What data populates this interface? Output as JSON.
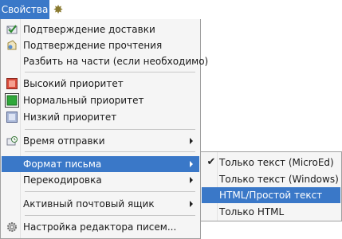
{
  "topbar": {
    "menu_label": "Свойства",
    "gear_icon": "gear-icon"
  },
  "menu": {
    "items": [
      {
        "label": "Подтверждение доставки",
        "icon": "delivery-receipt-icon"
      },
      {
        "label": "Подтверждение прочтения",
        "icon": "read-receipt-icon"
      },
      {
        "label": "Разбить на части (если необходимо)",
        "icon": ""
      },
      {
        "label": "Высокий приоритет",
        "icon": "priority-high-icon"
      },
      {
        "label": "Нормальный приоритет",
        "icon": "priority-normal-icon"
      },
      {
        "label": "Низкий приоритет",
        "icon": "priority-low-icon"
      },
      {
        "label": "Время отправки",
        "icon": "send-time-icon"
      },
      {
        "label": "Формат письма",
        "icon": ""
      },
      {
        "label": "Перекодировка",
        "icon": ""
      },
      {
        "label": "Активный почтовый ящик",
        "icon": ""
      },
      {
        "label": "Настройка редактора писем...",
        "icon": "gear-icon"
      }
    ]
  },
  "submenu": {
    "items": [
      {
        "label": "Только текст (MicroEd)",
        "checked": true
      },
      {
        "label": "Только текст (Windows)",
        "checked": false
      },
      {
        "label": "HTML/Простой текст",
        "checked": false
      },
      {
        "label": "Только HTML",
        "checked": false
      }
    ]
  },
  "colors": {
    "highlight": "#3a78c8",
    "menu_bg": "#f5f5f5"
  }
}
